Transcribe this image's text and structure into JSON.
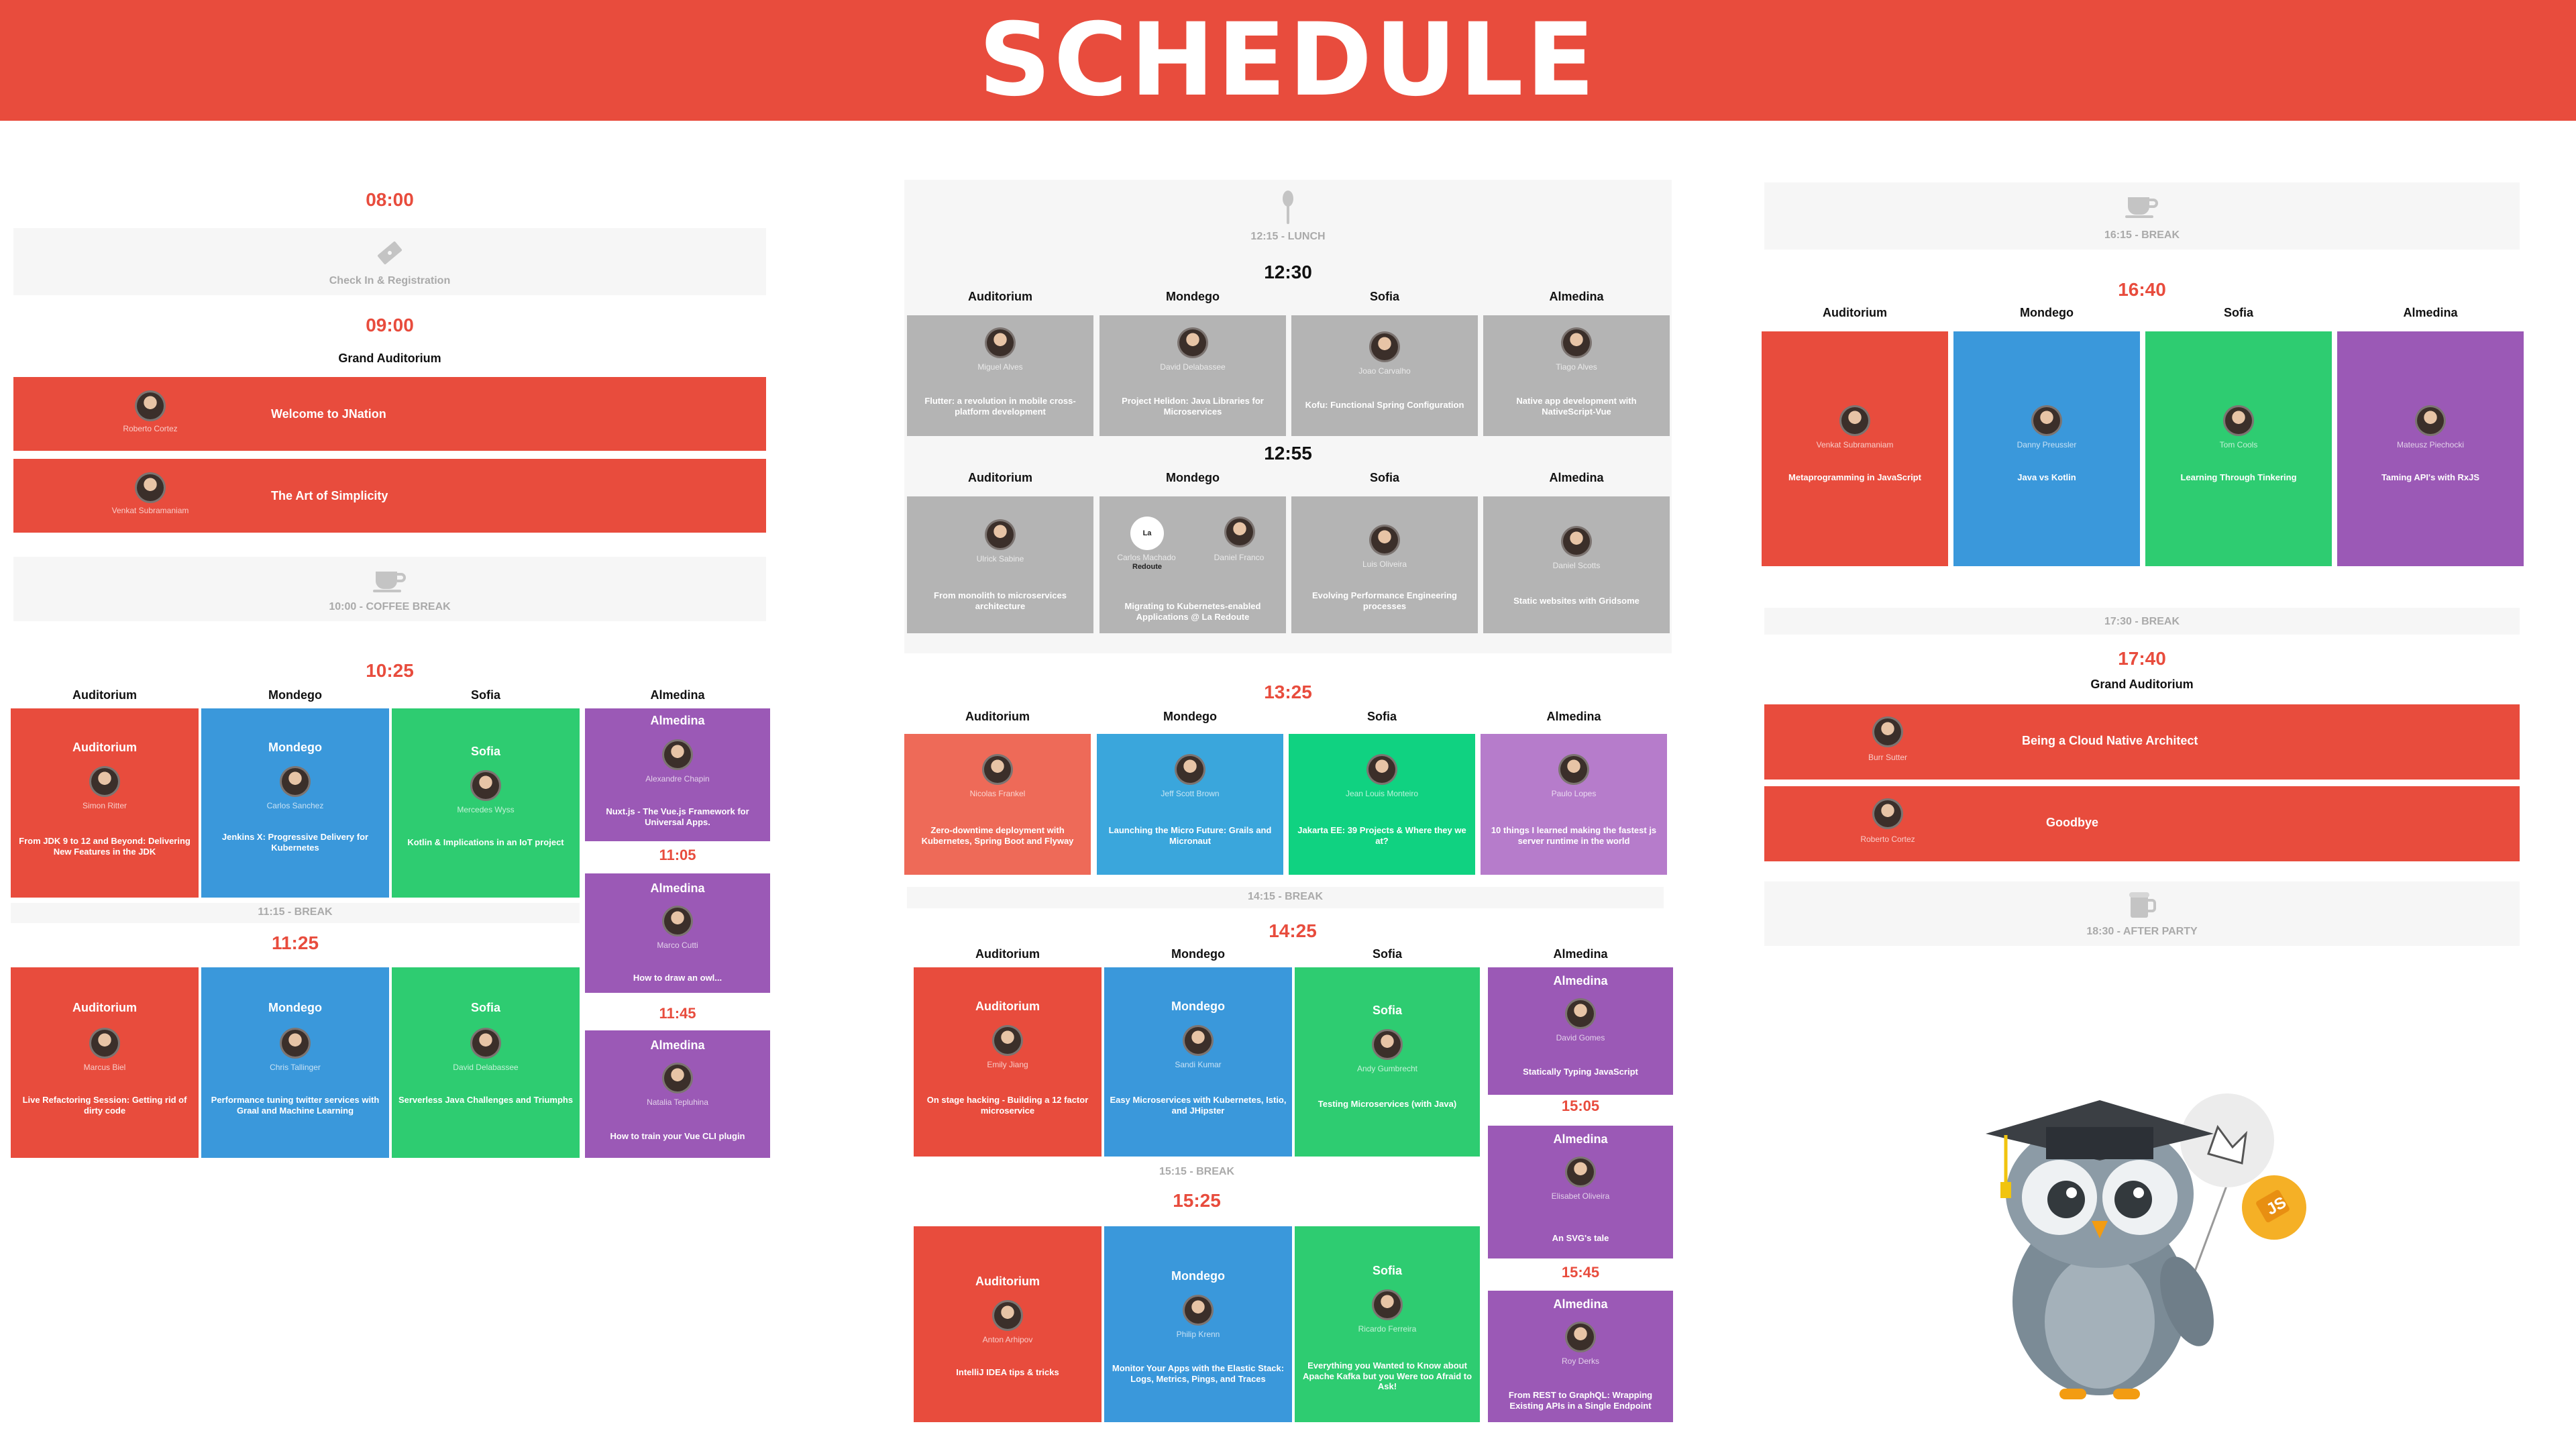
{
  "header": {
    "title": "SCHEDULE"
  },
  "col1": {
    "t0800": "08:00",
    "checkin": "Check In & Registration",
    "t0900": "09:00",
    "grand": "Grand Auditorium",
    "welcome": {
      "speaker": "Roberto Cortez",
      "title": "Welcome to JNation"
    },
    "simplicity": {
      "speaker": "Venkat Subramaniam",
      "title": "The Art of Simplicity"
    },
    "coffee": "10:00 - COFFEE BREAK",
    "t1025": "10:25",
    "rooms": [
      "Auditorium",
      "Mondego",
      "Sofia",
      "Almedina"
    ],
    "s1025": [
      {
        "room": "Auditorium",
        "speaker": "Simon Ritter",
        "title": "From JDK 9 to 12 and Beyond: Delivering New Features in the JDK"
      },
      {
        "room": "Mondego",
        "speaker": "Carlos Sanchez",
        "title": "Jenkins X: Progressive Delivery for Kubernetes"
      },
      {
        "room": "Sofia",
        "speaker": "Mercedes Wyss",
        "title": "Kotlin & Implications in an IoT project"
      },
      {
        "room": "Almedina",
        "speaker": "Alexandre Chapin",
        "title": "Nuxt.js - The Vue.js Framework for Universal Apps."
      }
    ],
    "t1105": "11:05",
    "alm1105": {
      "room": "Almedina",
      "speaker": "Marco Cutti",
      "title": "How to draw an owl..."
    },
    "break1115": "11:15 - BREAK",
    "t1125": "11:25",
    "t1145": "11:45",
    "s1125": [
      {
        "room": "Auditorium",
        "speaker": "Marcus Biel",
        "title": "Live Refactoring Session: Getting rid of dirty code"
      },
      {
        "room": "Mondego",
        "speaker": "Chris Tallinger",
        "title": "Performance tuning twitter services with Graal and Machine Learning"
      },
      {
        "room": "Sofia",
        "speaker": "David Delabassee",
        "title": "Serverless Java Challenges and Triumphs"
      }
    ],
    "alm1145": {
      "room": "Almedina",
      "speaker": "Natalia Tepluhina",
      "title": "How to train your Vue CLI plugin"
    }
  },
  "col2": {
    "lunch": "12:15 - LUNCH",
    "t1230": "12:30",
    "rooms": [
      "Auditorium",
      "Mondego",
      "Sofia",
      "Almedina"
    ],
    "s1230": [
      {
        "speaker": "Miguel Alves",
        "title": "Flutter: a revolution in mobile cross-platform development"
      },
      {
        "speaker": "David Delabassee",
        "title": "Project Helidon: Java Libraries for Microservices"
      },
      {
        "speaker": "Joao Carvalho",
        "title": "Kofu: Functional Spring Configuration"
      },
      {
        "speaker": "Tiago Alves",
        "title": "Native app development with NativeScript-Vue"
      }
    ],
    "t1255": "12:55",
    "s1255": [
      {
        "speaker": "Ulrick Sabine",
        "title": "From monolith to microservices architecture"
      },
      {
        "speaker": "Carlos Machado",
        "speaker2": "Daniel Franco",
        "logo": "La Redoute",
        "title": "Migrating to Kubernetes-enabled Applications @ La Redoute"
      },
      {
        "speaker": "Luis Oliveira",
        "title": "Evolving Performance Engineering processes"
      },
      {
        "speaker": "Daniel Scotts",
        "title": "Static websites with Gridsome"
      }
    ],
    "t1325": "13:25",
    "s1325": [
      {
        "speaker": "Nicolas Frankel",
        "title": "Zero-downtime deployment with Kubernetes, Spring Boot and Flyway"
      },
      {
        "speaker": "Jeff Scott Brown",
        "title": "Launching the Micro Future: Grails and Micronaut"
      },
      {
        "speaker": "Jean Louis Monteiro",
        "title": "Jakarta EE: 39 Projects & Where they we at?"
      },
      {
        "speaker": "Paulo Lopes",
        "title": "10 things I learned making the fastest js server runtime in the world"
      }
    ],
    "break1415": "14:15 - BREAK",
    "t1425": "14:25",
    "s1425": [
      {
        "room": "Auditorium",
        "speaker": "Emily Jiang",
        "title": "On stage hacking - Building a 12 factor microservice"
      },
      {
        "room": "Mondego",
        "speaker": "Sandi Kumar",
        "title": "Easy Microservices with Kubernetes, Istio, and JHipster"
      },
      {
        "room": "Sofia",
        "speaker": "Andy Gumbrecht",
        "title": "Testing Microservices (with Java)"
      },
      {
        "room": "Almedina",
        "speaker": "David Gomes",
        "title": "Statically Typing JavaScript"
      }
    ],
    "t1505": "15:05",
    "alm1505": {
      "room": "Almedina",
      "speaker": "Elisabet Oliveira",
      "title": "An SVG's tale"
    },
    "break1515": "15:15 - BREAK",
    "t1525": "15:25",
    "t1545": "15:45",
    "s1525": [
      {
        "room": "Auditorium",
        "speaker": "Anton Arhipov",
        "title": "IntelliJ IDEA tips & tricks"
      },
      {
        "room": "Mondego",
        "speaker": "Philip Krenn",
        "title": "Monitor Your Apps with the Elastic Stack: Logs, Metrics, Pings, and Traces"
      },
      {
        "room": "Sofia",
        "speaker": "Ricardo Ferreira",
        "title": "Everything you Wanted to Know about Apache Kafka but you Were too Afraid to Ask!"
      }
    ],
    "alm1545": {
      "room": "Almedina",
      "speaker": "Roy Derks",
      "title": "From REST to GraphQL: Wrapping Existing APIs in a Single Endpoint"
    }
  },
  "col3": {
    "break1615": "16:15 - BREAK",
    "t1640": "16:40",
    "rooms": [
      "Auditorium",
      "Mondego",
      "Sofia",
      "Almedina"
    ],
    "s1640": [
      {
        "speaker": "Venkat Subramaniam",
        "title": "Metaprogramming in JavaScript"
      },
      {
        "speaker": "Danny Preussler",
        "title": "Java vs Kotlin"
      },
      {
        "speaker": "Tom Cools",
        "title": "Learning Through Tinkering"
      },
      {
        "speaker": "Mateusz Piechocki",
        "title": "Taming API's with RxJS"
      }
    ],
    "break1730": "17:30 - BREAK",
    "t1740": "17:40",
    "grand": "Grand Auditorium",
    "native": {
      "speaker": "Burr Sutter",
      "title": "Being a Cloud Native Architect"
    },
    "goodbye": {
      "speaker": "Roberto Cortez",
      "title": "Goodbye"
    },
    "afterparty": "18:30 - AFTER PARTY"
  },
  "colors": {
    "red": "#e84c3d",
    "blue": "#3a98db",
    "green": "#2ecc71",
    "purple": "#9b59b6",
    "gray": "#b4b4b4"
  },
  "icons": [
    "ticket-icon",
    "coffee-cup-icon",
    "spoon-icon",
    "beer-mug-icon",
    "owl-mascot"
  ],
  "owl_badge": "JS"
}
